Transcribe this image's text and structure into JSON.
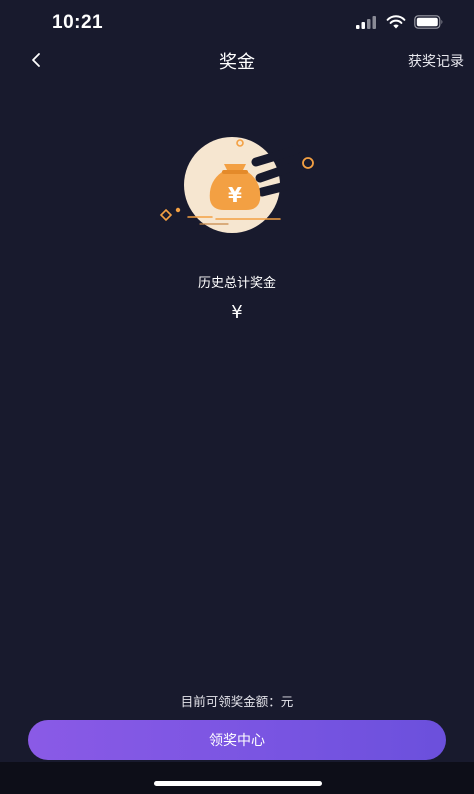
{
  "status_bar": {
    "time": "10:21"
  },
  "nav": {
    "title": "奖金",
    "records_label": "获奖记录"
  },
  "summary": {
    "total_label": "历史总计奖金",
    "total_value": "¥",
    "bag_symbol": "¥"
  },
  "footer": {
    "claimable_text": "目前可领奖金额：元",
    "claim_button_label": "领奖中心"
  },
  "colors": {
    "background": "#181a2d",
    "accent_orange": "#f3a043",
    "circle_fill": "#f6e6d0",
    "button_purple": "#7a55e2"
  }
}
